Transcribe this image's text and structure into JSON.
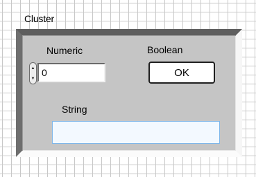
{
  "cluster": {
    "label": "Cluster",
    "numeric": {
      "label": "Numeric",
      "value": "0",
      "increment_glyph": "▲",
      "decrement_glyph": "▼"
    },
    "boolean": {
      "label": "Boolean",
      "button_text": "OK"
    },
    "string": {
      "label": "String",
      "value": ""
    }
  },
  "colors": {
    "grid_background": "#ffffff",
    "grid_lines": "#c8c8c8",
    "panel": "#c5c5c5",
    "string_border": "#7fb7ea",
    "string_fill": "#f3f9ff"
  }
}
